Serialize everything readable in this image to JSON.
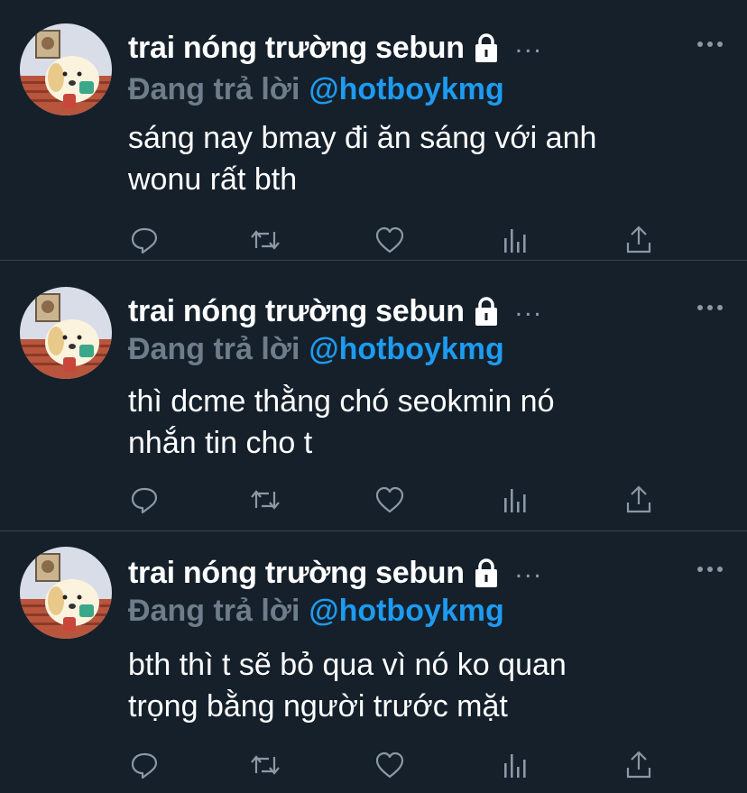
{
  "tweets": [
    {
      "display_name": "trai nóng trường sebun",
      "ellipsis": "...",
      "reply_prefix": "Đang trả lời",
      "reply_handle": "@hotboykmg",
      "lines": [
        "sáng nay bmay đi ăn sáng với anh",
        "wonu rất bth"
      ]
    },
    {
      "display_name": "trai nóng trường sebun",
      "ellipsis": "...",
      "reply_prefix": "Đang trả lời",
      "reply_handle": "@hotboykmg",
      "lines": [
        "thì dcme thằng chó seokmin nó",
        "nhắn tin cho t"
      ]
    },
    {
      "display_name": "trai nóng trường sebun",
      "ellipsis": "...",
      "reply_prefix": "Đang trả lời",
      "reply_handle": "@hotboykmg",
      "lines": [
        "bth thì t sẽ bỏ qua vì nó ko quan",
        "trọng bằng người trước mặt"
      ]
    }
  ],
  "icons": {
    "lock": "lock-icon",
    "more": "more-dots-icon",
    "reply": "reply-icon",
    "retweet": "retweet-icon",
    "like": "heart-icon",
    "analytics": "analytics-icon",
    "share": "share-icon"
  },
  "colors": {
    "background": "#15202b",
    "divider": "#38444d",
    "text": "#ffffff",
    "muted": "#8b98a5",
    "reply_prefix": "#6e7d8a",
    "link": "#1d9bf0"
  }
}
